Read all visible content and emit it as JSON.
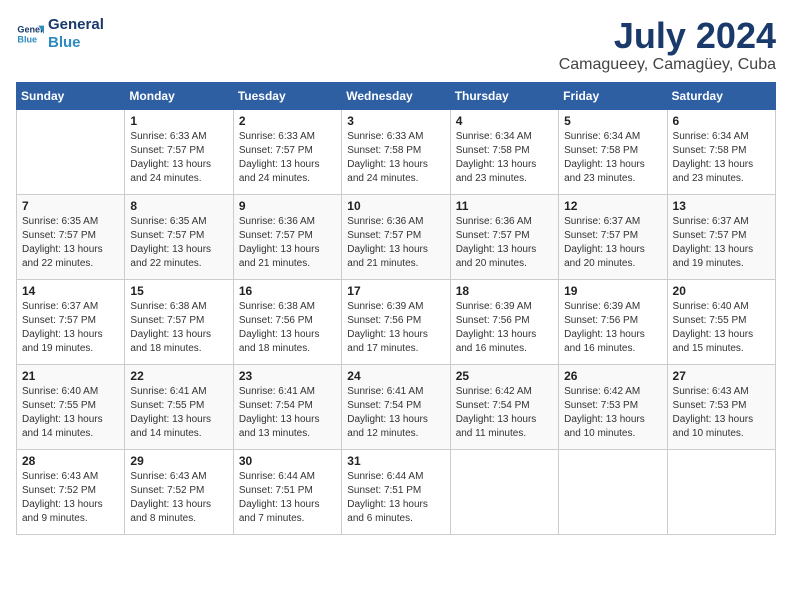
{
  "logo": {
    "line1": "General",
    "line2": "Blue"
  },
  "title": "July 2024",
  "location": "Camagueey, Camagüey, Cuba",
  "headers": [
    "Sunday",
    "Monday",
    "Tuesday",
    "Wednesday",
    "Thursday",
    "Friday",
    "Saturday"
  ],
  "weeks": [
    [
      {
        "day": "",
        "info": ""
      },
      {
        "day": "1",
        "info": "Sunrise: 6:33 AM\nSunset: 7:57 PM\nDaylight: 13 hours\nand 24 minutes."
      },
      {
        "day": "2",
        "info": "Sunrise: 6:33 AM\nSunset: 7:57 PM\nDaylight: 13 hours\nand 24 minutes."
      },
      {
        "day": "3",
        "info": "Sunrise: 6:33 AM\nSunset: 7:58 PM\nDaylight: 13 hours\nand 24 minutes."
      },
      {
        "day": "4",
        "info": "Sunrise: 6:34 AM\nSunset: 7:58 PM\nDaylight: 13 hours\nand 23 minutes."
      },
      {
        "day": "5",
        "info": "Sunrise: 6:34 AM\nSunset: 7:58 PM\nDaylight: 13 hours\nand 23 minutes."
      },
      {
        "day": "6",
        "info": "Sunrise: 6:34 AM\nSunset: 7:58 PM\nDaylight: 13 hours\nand 23 minutes."
      }
    ],
    [
      {
        "day": "7",
        "info": "Sunrise: 6:35 AM\nSunset: 7:57 PM\nDaylight: 13 hours\nand 22 minutes."
      },
      {
        "day": "8",
        "info": "Sunrise: 6:35 AM\nSunset: 7:57 PM\nDaylight: 13 hours\nand 22 minutes."
      },
      {
        "day": "9",
        "info": "Sunrise: 6:36 AM\nSunset: 7:57 PM\nDaylight: 13 hours\nand 21 minutes."
      },
      {
        "day": "10",
        "info": "Sunrise: 6:36 AM\nSunset: 7:57 PM\nDaylight: 13 hours\nand 21 minutes."
      },
      {
        "day": "11",
        "info": "Sunrise: 6:36 AM\nSunset: 7:57 PM\nDaylight: 13 hours\nand 20 minutes."
      },
      {
        "day": "12",
        "info": "Sunrise: 6:37 AM\nSunset: 7:57 PM\nDaylight: 13 hours\nand 20 minutes."
      },
      {
        "day": "13",
        "info": "Sunrise: 6:37 AM\nSunset: 7:57 PM\nDaylight: 13 hours\nand 19 minutes."
      }
    ],
    [
      {
        "day": "14",
        "info": "Sunrise: 6:37 AM\nSunset: 7:57 PM\nDaylight: 13 hours\nand 19 minutes."
      },
      {
        "day": "15",
        "info": "Sunrise: 6:38 AM\nSunset: 7:57 PM\nDaylight: 13 hours\nand 18 minutes."
      },
      {
        "day": "16",
        "info": "Sunrise: 6:38 AM\nSunset: 7:56 PM\nDaylight: 13 hours\nand 18 minutes."
      },
      {
        "day": "17",
        "info": "Sunrise: 6:39 AM\nSunset: 7:56 PM\nDaylight: 13 hours\nand 17 minutes."
      },
      {
        "day": "18",
        "info": "Sunrise: 6:39 AM\nSunset: 7:56 PM\nDaylight: 13 hours\nand 16 minutes."
      },
      {
        "day": "19",
        "info": "Sunrise: 6:39 AM\nSunset: 7:56 PM\nDaylight: 13 hours\nand 16 minutes."
      },
      {
        "day": "20",
        "info": "Sunrise: 6:40 AM\nSunset: 7:55 PM\nDaylight: 13 hours\nand 15 minutes."
      }
    ],
    [
      {
        "day": "21",
        "info": "Sunrise: 6:40 AM\nSunset: 7:55 PM\nDaylight: 13 hours\nand 14 minutes."
      },
      {
        "day": "22",
        "info": "Sunrise: 6:41 AM\nSunset: 7:55 PM\nDaylight: 13 hours\nand 14 minutes."
      },
      {
        "day": "23",
        "info": "Sunrise: 6:41 AM\nSunset: 7:54 PM\nDaylight: 13 hours\nand 13 minutes."
      },
      {
        "day": "24",
        "info": "Sunrise: 6:41 AM\nSunset: 7:54 PM\nDaylight: 13 hours\nand 12 minutes."
      },
      {
        "day": "25",
        "info": "Sunrise: 6:42 AM\nSunset: 7:54 PM\nDaylight: 13 hours\nand 11 minutes."
      },
      {
        "day": "26",
        "info": "Sunrise: 6:42 AM\nSunset: 7:53 PM\nDaylight: 13 hours\nand 10 minutes."
      },
      {
        "day": "27",
        "info": "Sunrise: 6:43 AM\nSunset: 7:53 PM\nDaylight: 13 hours\nand 10 minutes."
      }
    ],
    [
      {
        "day": "28",
        "info": "Sunrise: 6:43 AM\nSunset: 7:52 PM\nDaylight: 13 hours\nand 9 minutes."
      },
      {
        "day": "29",
        "info": "Sunrise: 6:43 AM\nSunset: 7:52 PM\nDaylight: 13 hours\nand 8 minutes."
      },
      {
        "day": "30",
        "info": "Sunrise: 6:44 AM\nSunset: 7:51 PM\nDaylight: 13 hours\nand 7 minutes."
      },
      {
        "day": "31",
        "info": "Sunrise: 6:44 AM\nSunset: 7:51 PM\nDaylight: 13 hours\nand 6 minutes."
      },
      {
        "day": "",
        "info": ""
      },
      {
        "day": "",
        "info": ""
      },
      {
        "day": "",
        "info": ""
      }
    ]
  ]
}
